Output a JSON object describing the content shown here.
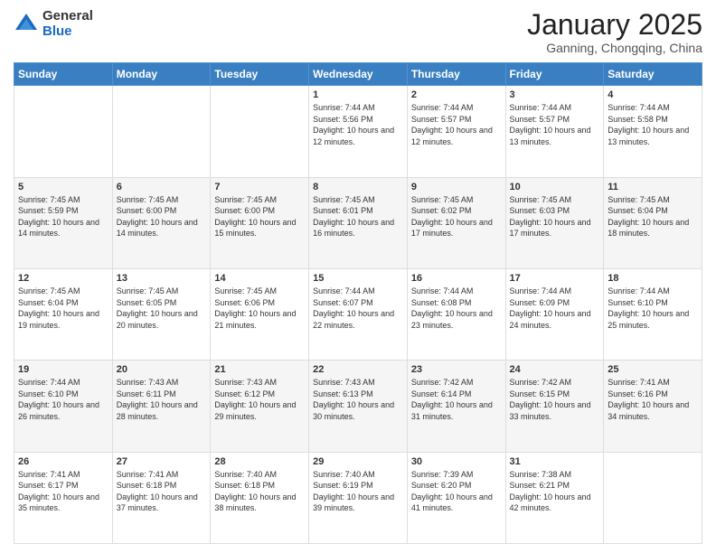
{
  "header": {
    "logo_general": "General",
    "logo_blue": "Blue",
    "month_title": "January 2025",
    "location": "Ganning, Chongqing, China"
  },
  "days_of_week": [
    "Sunday",
    "Monday",
    "Tuesday",
    "Wednesday",
    "Thursday",
    "Friday",
    "Saturday"
  ],
  "weeks": [
    [
      {
        "day": "",
        "info": ""
      },
      {
        "day": "",
        "info": ""
      },
      {
        "day": "",
        "info": ""
      },
      {
        "day": "1",
        "info": "Sunrise: 7:44 AM\nSunset: 5:56 PM\nDaylight: 10 hours and 12 minutes."
      },
      {
        "day": "2",
        "info": "Sunrise: 7:44 AM\nSunset: 5:57 PM\nDaylight: 10 hours and 12 minutes."
      },
      {
        "day": "3",
        "info": "Sunrise: 7:44 AM\nSunset: 5:57 PM\nDaylight: 10 hours and 13 minutes."
      },
      {
        "day": "4",
        "info": "Sunrise: 7:44 AM\nSunset: 5:58 PM\nDaylight: 10 hours and 13 minutes."
      }
    ],
    [
      {
        "day": "5",
        "info": "Sunrise: 7:45 AM\nSunset: 5:59 PM\nDaylight: 10 hours and 14 minutes."
      },
      {
        "day": "6",
        "info": "Sunrise: 7:45 AM\nSunset: 6:00 PM\nDaylight: 10 hours and 14 minutes."
      },
      {
        "day": "7",
        "info": "Sunrise: 7:45 AM\nSunset: 6:00 PM\nDaylight: 10 hours and 15 minutes."
      },
      {
        "day": "8",
        "info": "Sunrise: 7:45 AM\nSunset: 6:01 PM\nDaylight: 10 hours and 16 minutes."
      },
      {
        "day": "9",
        "info": "Sunrise: 7:45 AM\nSunset: 6:02 PM\nDaylight: 10 hours and 17 minutes."
      },
      {
        "day": "10",
        "info": "Sunrise: 7:45 AM\nSunset: 6:03 PM\nDaylight: 10 hours and 17 minutes."
      },
      {
        "day": "11",
        "info": "Sunrise: 7:45 AM\nSunset: 6:04 PM\nDaylight: 10 hours and 18 minutes."
      }
    ],
    [
      {
        "day": "12",
        "info": "Sunrise: 7:45 AM\nSunset: 6:04 PM\nDaylight: 10 hours and 19 minutes."
      },
      {
        "day": "13",
        "info": "Sunrise: 7:45 AM\nSunset: 6:05 PM\nDaylight: 10 hours and 20 minutes."
      },
      {
        "day": "14",
        "info": "Sunrise: 7:45 AM\nSunset: 6:06 PM\nDaylight: 10 hours and 21 minutes."
      },
      {
        "day": "15",
        "info": "Sunrise: 7:44 AM\nSunset: 6:07 PM\nDaylight: 10 hours and 22 minutes."
      },
      {
        "day": "16",
        "info": "Sunrise: 7:44 AM\nSunset: 6:08 PM\nDaylight: 10 hours and 23 minutes."
      },
      {
        "day": "17",
        "info": "Sunrise: 7:44 AM\nSunset: 6:09 PM\nDaylight: 10 hours and 24 minutes."
      },
      {
        "day": "18",
        "info": "Sunrise: 7:44 AM\nSunset: 6:10 PM\nDaylight: 10 hours and 25 minutes."
      }
    ],
    [
      {
        "day": "19",
        "info": "Sunrise: 7:44 AM\nSunset: 6:10 PM\nDaylight: 10 hours and 26 minutes."
      },
      {
        "day": "20",
        "info": "Sunrise: 7:43 AM\nSunset: 6:11 PM\nDaylight: 10 hours and 28 minutes."
      },
      {
        "day": "21",
        "info": "Sunrise: 7:43 AM\nSunset: 6:12 PM\nDaylight: 10 hours and 29 minutes."
      },
      {
        "day": "22",
        "info": "Sunrise: 7:43 AM\nSunset: 6:13 PM\nDaylight: 10 hours and 30 minutes."
      },
      {
        "day": "23",
        "info": "Sunrise: 7:42 AM\nSunset: 6:14 PM\nDaylight: 10 hours and 31 minutes."
      },
      {
        "day": "24",
        "info": "Sunrise: 7:42 AM\nSunset: 6:15 PM\nDaylight: 10 hours and 33 minutes."
      },
      {
        "day": "25",
        "info": "Sunrise: 7:41 AM\nSunset: 6:16 PM\nDaylight: 10 hours and 34 minutes."
      }
    ],
    [
      {
        "day": "26",
        "info": "Sunrise: 7:41 AM\nSunset: 6:17 PM\nDaylight: 10 hours and 35 minutes."
      },
      {
        "day": "27",
        "info": "Sunrise: 7:41 AM\nSunset: 6:18 PM\nDaylight: 10 hours and 37 minutes."
      },
      {
        "day": "28",
        "info": "Sunrise: 7:40 AM\nSunset: 6:18 PM\nDaylight: 10 hours and 38 minutes."
      },
      {
        "day": "29",
        "info": "Sunrise: 7:40 AM\nSunset: 6:19 PM\nDaylight: 10 hours and 39 minutes."
      },
      {
        "day": "30",
        "info": "Sunrise: 7:39 AM\nSunset: 6:20 PM\nDaylight: 10 hours and 41 minutes."
      },
      {
        "day": "31",
        "info": "Sunrise: 7:38 AM\nSunset: 6:21 PM\nDaylight: 10 hours and 42 minutes."
      },
      {
        "day": "",
        "info": ""
      }
    ]
  ]
}
